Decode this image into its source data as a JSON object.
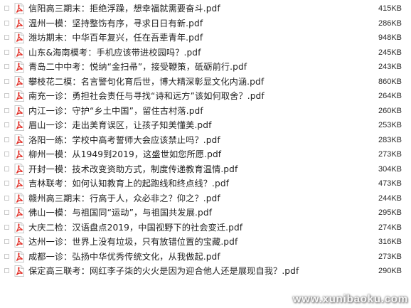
{
  "theme": {
    "pdf_icon_color": "#e2322a",
    "row_text_color": "#1f1f1f"
  },
  "files": [
    {
      "name": "信阳高三期末：拒绝浮躁，想幸福就需要奋斗.pdf",
      "size": "415KB",
      "icon": "pdf-icon"
    },
    {
      "name": "温州一模：坚持整饬有序，寻求日日有新.pdf",
      "size": "286KB",
      "icon": "pdf-icon"
    },
    {
      "name": "潍坊期末：中华百年复兴，任在吾辈青年.pdf",
      "size": "948KB",
      "icon": "pdf-icon"
    },
    {
      "name": "山东&海南模考：手机应该带进校园吗？.pdf",
      "size": "245KB",
      "icon": "pdf-icon"
    },
    {
      "name": "青岛二中中考：悦纳“金扫帚”，接受鞭策，砥砺前行.pdf",
      "size": "243KB",
      "icon": "pdf-icon"
    },
    {
      "name": "攀枝花二模：名言警句化育后世，博大精深彰显文化内涵.pdf",
      "size": "860KB",
      "icon": "pdf-icon"
    },
    {
      "name": "南充一诊：勇担社会责任与寻找“诗和远方”该如何取舍？.pdf",
      "size": "264KB",
      "icon": "pdf-icon"
    },
    {
      "name": "内江一诊：守护“乡土中国”，留住古村落.pdf",
      "size": "260KB",
      "icon": "pdf-icon"
    },
    {
      "name": "眉山一诊：走出美育误区，让孩子知美懂美.pdf",
      "size": "253KB",
      "icon": "pdf-icon"
    },
    {
      "name": "洛阳一练：学校中高考誓师大会应该禁止吗？.pdf",
      "size": "283KB",
      "icon": "pdf-icon"
    },
    {
      "name": "柳州一模：从1949到2019，这盛世如您所愿.pdf",
      "size": "273KB",
      "icon": "pdf-icon"
    },
    {
      "name": "开封一模：技术改变资助方式，制度传递教育温情.pdf",
      "size": "304KB",
      "icon": "pdf-icon"
    },
    {
      "name": "吉林联考：如何认知教育上的起跑线和终点线？.pdf",
      "size": "473KB",
      "icon": "pdf-icon"
    },
    {
      "name": "赣州高三期末：行高于人，众必非之？仰之？.pdf",
      "size": "244KB",
      "icon": "pdf-icon"
    },
    {
      "name": "佛山一模：与祖国同“运动”，与祖国共发展.pdf",
      "size": "295KB",
      "icon": "pdf-icon"
    },
    {
      "name": "大庆二检：汉语盘点2019，中国视野下的社会变迁.pdf",
      "size": "274KB",
      "icon": "pdf-icon"
    },
    {
      "name": "达州一诊：世界上没有垃圾，只有放错位置的宝藏.pdf",
      "size": "316KB",
      "icon": "pdf-icon"
    },
    {
      "name": "成都一诊：弘扬中华优秀传统文化，从我做起.pdf",
      "size": "273KB",
      "icon": "pdf-icon"
    },
    {
      "name": "保定高三联考：网红李子柒的火火是因为迎合他人还是展现自我？.pdf",
      "size": "290KB",
      "icon": "pdf-icon"
    }
  ],
  "watermark": "www.xunibaoku.com"
}
